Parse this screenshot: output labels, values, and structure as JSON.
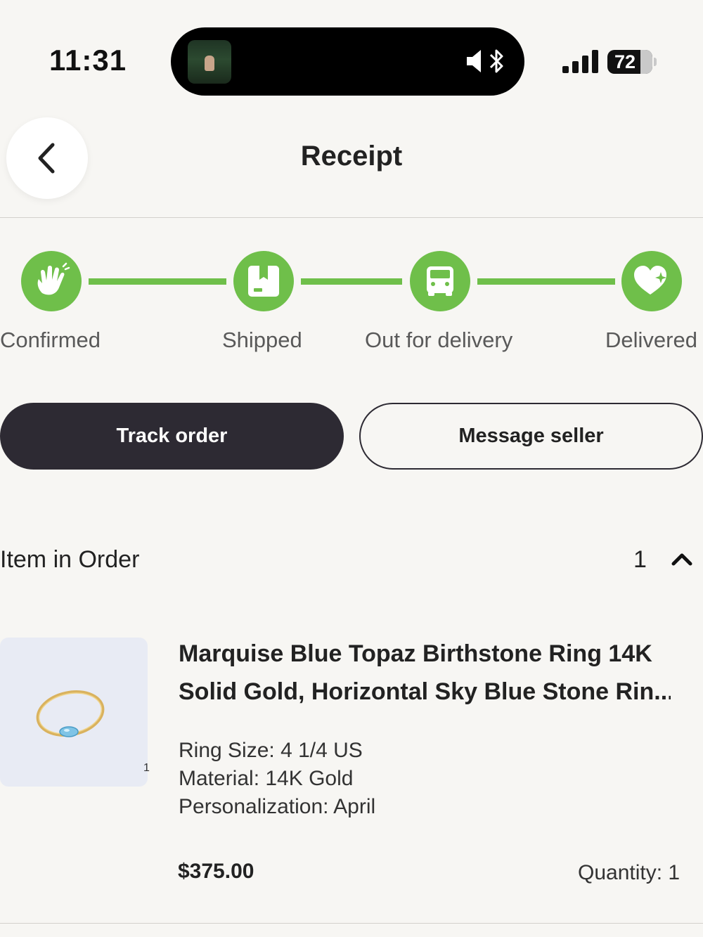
{
  "status_bar": {
    "time": "11:31",
    "battery": "72"
  },
  "header": {
    "title": "Receipt"
  },
  "progress": {
    "color": "#6fbf4a",
    "steps": [
      {
        "label": "Confirmed",
        "icon": "waving-hand-icon"
      },
      {
        "label": "Shipped",
        "icon": "package-icon"
      },
      {
        "label": "Out for delivery",
        "icon": "truck-icon"
      },
      {
        "label": "Delivered",
        "icon": "heart-sparkle-icon"
      }
    ]
  },
  "actions": {
    "track_label": "Track order",
    "message_label": "Message seller"
  },
  "items_section": {
    "title": "Item in Order",
    "count": "1",
    "toggle_icon": "chevron-up-icon"
  },
  "item": {
    "title_line1": "Marquise Blue Topaz Birthstone Ring 14K",
    "title_line2": "Solid Gold, Horizontal Sky Blue Stone Rin...",
    "image_tag": "1",
    "attributes": [
      "Ring Size: 4 1/4 US",
      "Material: 14K Gold",
      "Personalization: April"
    ],
    "price": "$375.00",
    "quantity": "Quantity: 1"
  }
}
